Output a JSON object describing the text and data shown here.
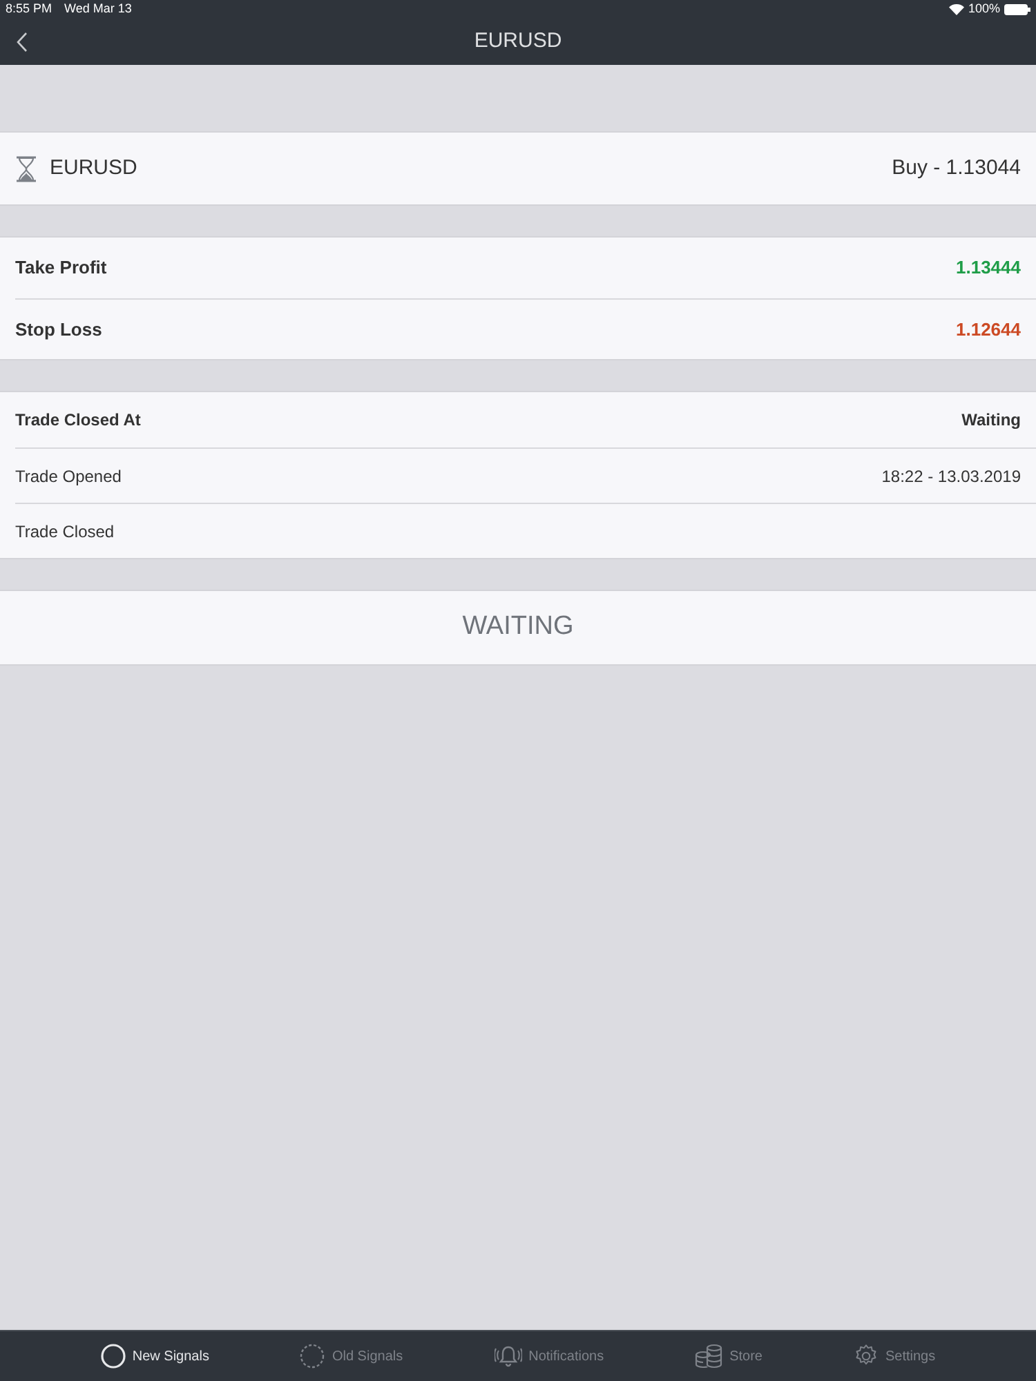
{
  "status_bar": {
    "time": "8:55 PM",
    "date": "Wed Mar 13",
    "battery": "100%"
  },
  "nav_bar": {
    "title": "EURUSD"
  },
  "signal": {
    "symbol": "EURUSD",
    "direction": "Buy - 1.13044"
  },
  "targets": [
    {
      "label": "Take Profit",
      "value": "1.13444",
      "color": "#1f9d48"
    },
    {
      "label": "Stop Loss",
      "value": "1.12644",
      "color": "#cc4a24"
    }
  ],
  "trade_info": [
    {
      "kind": "header",
      "label": "Trade Closed At",
      "value": "Waiting"
    },
    {
      "kind": "detail",
      "label": "Trade Opened",
      "value": "18:22 - 13.03.2019"
    },
    {
      "kind": "detail",
      "label": "Trade Closed"
    }
  ],
  "status_button": {
    "label": "WAITING"
  },
  "tab_bar": [
    {
      "label": "New Signals",
      "selected": true
    },
    {
      "label": "Old Signals",
      "selected": false
    },
    {
      "label": "Notifications",
      "selected": false
    },
    {
      "label": "Store",
      "selected": false
    },
    {
      "label": "Settings",
      "selected": false
    }
  ]
}
